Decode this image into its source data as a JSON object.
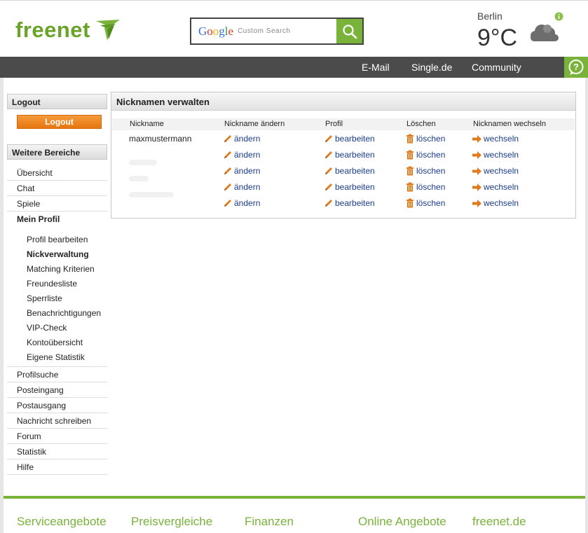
{
  "header": {
    "logo_text": "freenet",
    "search": {
      "brand": "Google",
      "placeholder": "Custom Search"
    },
    "weather": {
      "city": "Berlin",
      "temperature": "9°C",
      "condition_icon": "cloud-icon"
    }
  },
  "nav": {
    "items": [
      "E-Mail",
      "Single.de",
      "Community"
    ],
    "help_icon": "help-icon"
  },
  "sidebar": {
    "logout_title": "Logout",
    "logout_button": "Logout",
    "areas_title": "Weitere Bereiche",
    "items_top": [
      "Übersicht",
      "Chat",
      "Spiele"
    ],
    "my_profile": "Mein Profil",
    "profile_sub": [
      "Profil bearbeiten",
      "Nickverwaltung",
      "Matching Kriterien",
      "Freundesliste",
      "Sperrliste",
      "Benachrichtigungen",
      "VIP-Check",
      "Kontoübersicht",
      "Eigene Statistik"
    ],
    "active_sub": "Nickverwaltung",
    "items_bottom": [
      "Profilsuche",
      "Posteingang",
      "Postausgang",
      "Nachricht schreiben",
      "Forum",
      "Statistik",
      "Hilfe"
    ]
  },
  "main": {
    "title": "Nicknamen verwalten",
    "columns": [
      "Nickname",
      "Nickname ändern",
      "Profil",
      "Löschen",
      "Nicknamen wechseln"
    ],
    "rows": [
      {
        "nickname": "maxmustermann",
        "change": "ändern",
        "profile": "bearbeiten",
        "delete": "löschen",
        "switch": "wechseln"
      },
      {
        "nickname": "",
        "change": "ändern",
        "profile": "bearbeiten",
        "delete": "löschen",
        "switch": "wechseln"
      },
      {
        "nickname": "",
        "change": "ändern",
        "profile": "bearbeiten",
        "delete": "löschen",
        "switch": "wechseln"
      },
      {
        "nickname": "",
        "change": "ändern",
        "profile": "bearbeiten",
        "delete": "löschen",
        "switch": "wechseln"
      },
      {
        "nickname": "",
        "change": "ändern",
        "profile": "bearbeiten",
        "delete": "löschen",
        "switch": "wechseln"
      }
    ]
  },
  "footer": {
    "links": [
      "Serviceangebote",
      "Preisvergleiche",
      "Finanzen",
      "Online Angebote",
      "freenet.de"
    ]
  },
  "colors": {
    "brand_green": "#79b33a",
    "nav_bg": "#4b4b4b",
    "link_blue": "#1a3c8c",
    "button_orange": "#e6760f"
  }
}
